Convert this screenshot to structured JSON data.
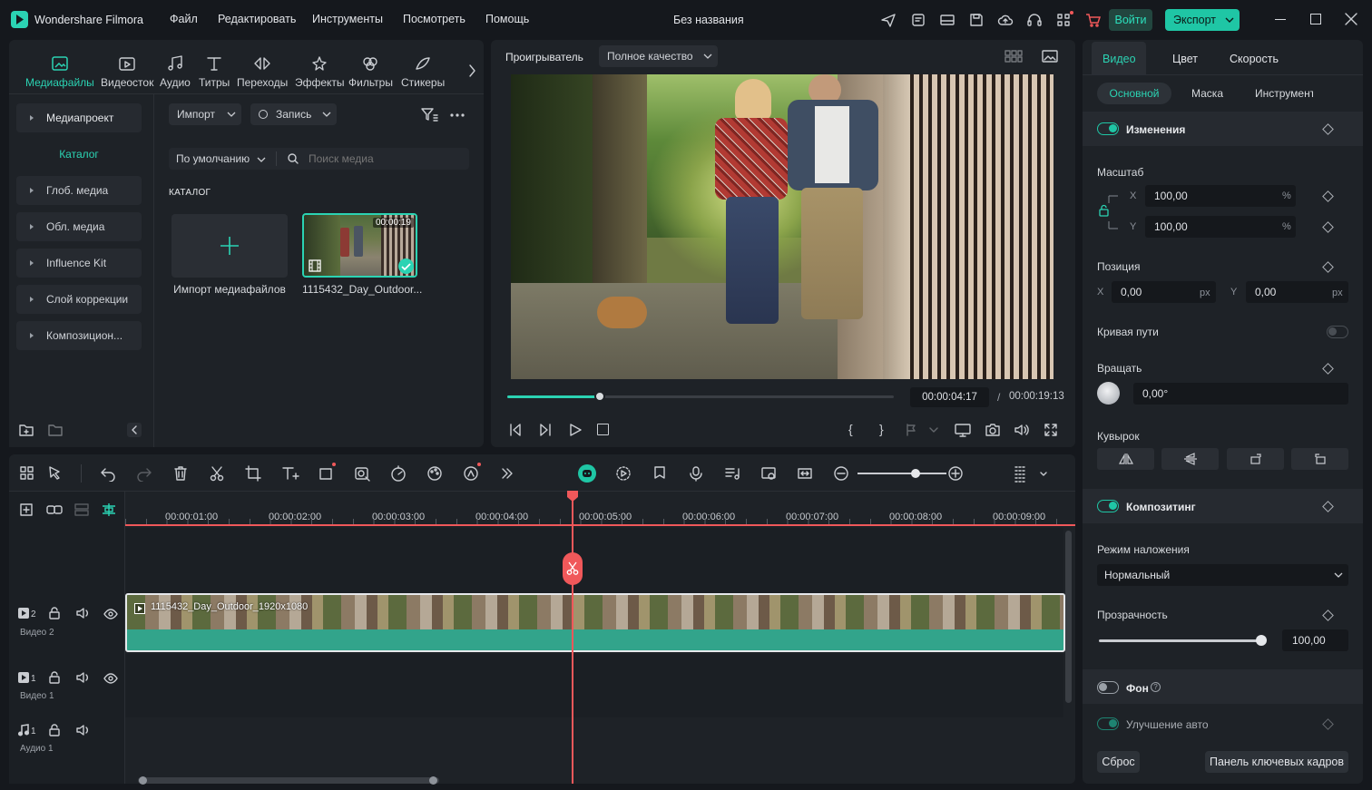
{
  "app": {
    "name": "Wondershare Filmora",
    "project_title": "Без названия"
  },
  "menu": [
    "Файл",
    "Редактировать",
    "Инструменты",
    "Посмотреть",
    "Помощь"
  ],
  "header": {
    "login_label": "Войти",
    "export_label": "Экспорт"
  },
  "toolbar_tabs": [
    "Медиафайлы",
    "Видеосток",
    "Аудио",
    "Титры",
    "Переходы",
    "Эффекты",
    "Фильтры",
    "Стикеры"
  ],
  "sidebar": {
    "items": [
      "Медиапроект",
      "Каталог",
      "Глоб. медиа",
      "Обл. медиа",
      "Influence Kit",
      "Слой коррекции",
      "Композицион..."
    ]
  },
  "media": {
    "import_label": "Импорт",
    "record_label": "Запись",
    "sort_label": "По умолчанию",
    "search_placeholder": "Поиск медиа",
    "section_label": "КАТАЛОГ",
    "import_tile_label": "Импорт медиафайлов",
    "clip_name": "1115432_Day_Outdoor...",
    "clip_duration": "00:00:19"
  },
  "player": {
    "label": "Проигрыватель",
    "quality": "Полное качество",
    "current_time": "00:00:04:17",
    "separator": "/",
    "total_time": "00:00:19:13",
    "progress": 0.24
  },
  "props": {
    "tabs": [
      "Видео",
      "Цвет",
      "Скорость"
    ],
    "subtabs": [
      "Основной",
      "Маска",
      "Инструмент"
    ],
    "transform_label": "Изменения",
    "scale_label": "Масштаб",
    "scale_x": "100,00",
    "scale_y": "100,00",
    "percent": "%",
    "axis_x": "X",
    "axis_y": "Y",
    "position_label": "Позиция",
    "pos_x": "0,00",
    "pos_y": "0,00",
    "px": "px",
    "path_curve_label": "Кривая пути",
    "rotate_label": "Вращать",
    "rotate_value": "0,00°",
    "flip_label": "Кувырок",
    "compositing_label": "Композитинг",
    "blend_label": "Режим наложения",
    "blend_value": "Нормальный",
    "opacity_label": "Прозрачность",
    "opacity_value": "100,00",
    "background_label": "Фон",
    "auto_enhance_label": "Улучшение авто",
    "reset_label": "Сброс",
    "keyframe_label": "Панель ключевых кадров"
  },
  "timeline": {
    "ticks": [
      "00:00:01:00",
      "00:00:02:00",
      "00:00:03:00",
      "00:00:04:00",
      "00:00:05:00",
      "00:00:06:00",
      "00:00:07:00",
      "00:00:08:00",
      "00:00:09:00"
    ],
    "clip_label": "1115432_Day_Outdoor_1920x1080",
    "tracks": [
      {
        "num": "2",
        "name": "Видео 2"
      },
      {
        "num": "1",
        "name": "Видео 1"
      },
      {
        "num": "1",
        "name": "Аудио 1"
      }
    ]
  },
  "colors": {
    "accent": "#1fc6a5",
    "playhead": "#f0585a",
    "bg": "#15181d",
    "panel": "#1e2227"
  }
}
